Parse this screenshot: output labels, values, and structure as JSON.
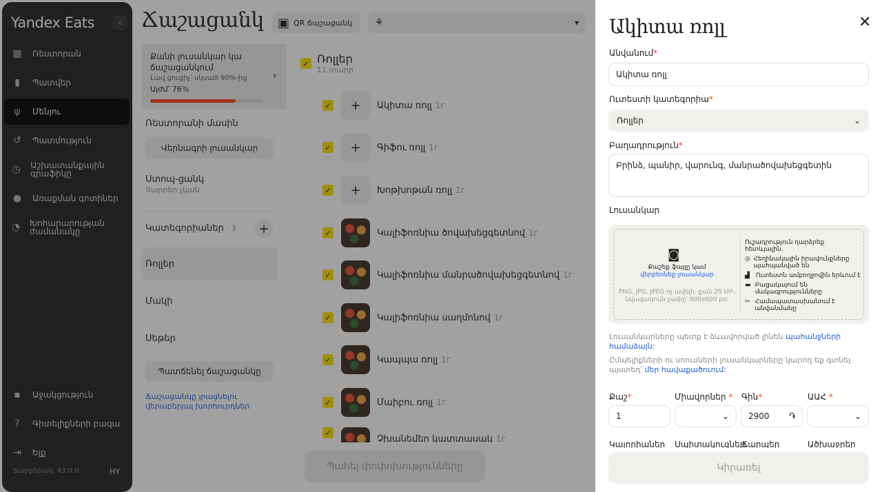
{
  "sidebar": {
    "brand": "Yandex Eats",
    "collapse_icon": "‹",
    "nav_top": [
      {
        "icon": "▦",
        "label": "Ռեստորան"
      },
      {
        "icon": "▮",
        "label": "Պատվեր"
      },
      {
        "icon": "ψ",
        "label": "Մենյու"
      },
      {
        "icon": "↺",
        "label": "Պատմություն"
      },
      {
        "icon": "◷",
        "label": "Աշխատանքային գրաֆիկը"
      },
      {
        "icon": "●",
        "label": "Առաքման գոտիներ"
      },
      {
        "icon": "◔",
        "label": "Խոհարարության ժամանակը"
      }
    ],
    "nav_bottom": [
      {
        "icon": "▪",
        "label": "Աջակցություն"
      },
      {
        "icon": "?",
        "label": "Գիտելիքների բազա"
      },
      {
        "icon": "⇥",
        "label": "Ելք"
      }
    ],
    "version": "Տարբերակ՝ 43.0.0",
    "lang": "HY"
  },
  "header": {
    "title": "Ճաշացանկ",
    "qr_label": "QR ճաշացանկ",
    "qr_icon": "▣",
    "restaurant_icon": "⚘",
    "restaurant_value": ""
  },
  "left": {
    "progress": {
      "title": "Քանի լուսանկար կա ճաշացանկում",
      "hint": "Լավ ցուցիչ՝ սկսած 90%-ից",
      "now": "Այժմ՝ 76%",
      "fill": 0.76,
      "arrow": "›"
    },
    "about": "Ռեստորանի մասին",
    "edit_photo": "Վերնագրի լուսանկար",
    "stop_list": "Ստոպ-ցանկ",
    "stop_sub": "Տարրեր չկան",
    "categories_label": "Կատեգորիաներ",
    "categories_count": "· 3",
    "plus": "+",
    "categories": [
      "Ռոլլեր",
      "Մակի",
      "Սեթեր"
    ],
    "hide_menu": "Պատճենել ճաշացանկը",
    "help": "Ճաշացանկը լրացնելու վերաբերյալ խորհուրդներ"
  },
  "list": {
    "group_name": "Ռոլլեր",
    "group_sub": "11 տարր",
    "check": "✓",
    "dishes": [
      {
        "name": "Ակիտա ռոլլ",
        "weight": "1г",
        "photo": false
      },
      {
        "name": "Գիֆու ռոլլ",
        "weight": "1г",
        "photo": false
      },
      {
        "name": "Խոթխոթան ռոլլ",
        "weight": "1г",
        "photo": false
      },
      {
        "name": "Կալիֆոռնիա ծովախեցգետնով",
        "weight": "1г",
        "photo": true
      },
      {
        "name": "Կալիֆոռնիա մանրածովախեցգետնով",
        "weight": "1г",
        "photo": true
      },
      {
        "name": "Կալիֆոռնիա սաղմոնով",
        "weight": "1г",
        "photo": true
      },
      {
        "name": "Կապպա ռոլլ",
        "weight": "1г",
        "photo": true
      },
      {
        "name": "Մաիբու ռոլլ",
        "weight": "1г",
        "photo": true
      },
      {
        "name": "Չխանեմեր կատտասակ",
        "weight": "1г",
        "photo": true
      }
    ],
    "save": "Պահել փոփոխությունները"
  },
  "drawer": {
    "title": "Ակիտա ռոլլ",
    "close_icon": "✕",
    "name_label": "Անվանում",
    "name_value": "Ակիտա ռոլլ",
    "req": "*",
    "category_label": "Ուտեստի կատեգորիա",
    "category_value": "Ռոլլեր",
    "composition_label": "Բաղադրություն",
    "composition_value": "Բրինձ, պանիր, վարունգ, մանրածովախեցգետին",
    "photo_label": "Լուսանկար",
    "upload": {
      "camera_icon": "◙",
      "choose": "Քաշեք ֆայլը կամ",
      "choose_link": "վերբեռնեք լուսանկար",
      "formats": "PNG, JPG, JPEG ոչ ավելի, քան 25 ՄԲ, նվազագույն չափը՝ 800x600 px:",
      "tips_title": "Ուշադրություն դարձրեք հետևյալին.",
      "tips": [
        {
          "icon": "◎",
          "text": "Հեղինակային իրավունքները պահպանված են"
        },
        {
          "icon": "▟",
          "text": "Ուտեստն ամբողջովին երևում է"
        },
        {
          "icon": "▬",
          "text": "Բացակայում են մակագրությունները"
        },
        {
          "icon": "✂",
          "text": "Համապատասխանում է անվանմանը"
        }
      ]
    },
    "note1": "Լուսանկարները պետք է ձևավորված լինեն",
    "note1_link": "պահանջների համաձայն:",
    "note2": "Ըմպելիքների ու սոուսների լուսանկարները կարող եք գտնել այստեղ՝",
    "note2_link": "մեր հավաքածուում:",
    "weight_label": "Քաշ",
    "weight_value": "1",
    "units_label": "Միավորներ",
    "price_label": "Գին",
    "price_value": "2900",
    "currency": "֏",
    "vat_label": "ԱԱՀ",
    "chev": "⌄",
    "bottom_labels": [
      "Կալորիաներ",
      "Սպիտակուցներ",
      "Ճարպեր",
      "Ածխաջրեր"
    ],
    "apply": "Կիրառել"
  }
}
